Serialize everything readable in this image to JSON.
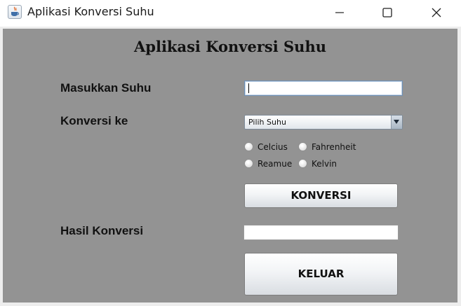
{
  "window": {
    "title": "Aplikasi Konversi Suhu",
    "controls": [
      "minimize-icon",
      "maximize-icon",
      "close-icon"
    ]
  },
  "form": {
    "heading": "Aplikasi Konversi Suhu",
    "input_label": "Masukkan Suhu",
    "input_value": "",
    "convert_label": "Konversi ke",
    "combo_selected": "Pilih Suhu",
    "radios": [
      "Celcius",
      "Fahrenheit",
      "Reamue",
      "Kelvin"
    ],
    "convert_button": "KONVERSI",
    "result_label": "Hasil Konversi",
    "result_value": "",
    "exit_button": "KELUAR"
  },
  "colors": {
    "panel_background": "#939393",
    "titlebar_background": "#ffffff"
  }
}
